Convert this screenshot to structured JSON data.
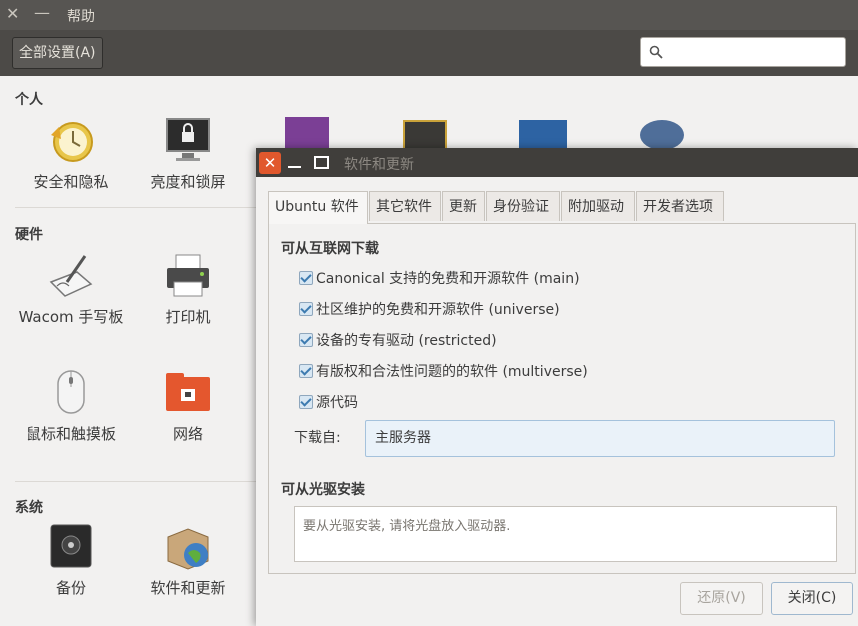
{
  "background_window": {
    "title": "帮助",
    "toolbar": {
      "all_settings_label": "全部设置(A)",
      "search_placeholder": ""
    },
    "sections": [
      {
        "title": "个人",
        "items": [
          "安全和隐私",
          "亮度和锁屏"
        ]
      },
      {
        "title": "硬件",
        "items": [
          "Wacom 手写板",
          "打印机",
          "鼠标和触摸板",
          "网络"
        ]
      },
      {
        "title": "系统",
        "items": [
          "备份",
          "软件和更新"
        ]
      }
    ]
  },
  "dialog": {
    "title": "软件和更新",
    "tabs": [
      "Ubuntu 软件",
      "其它软件",
      "更新",
      "身份验证",
      "附加驱动",
      "开发者选项"
    ],
    "active_tab": "Ubuntu 软件",
    "internet_heading": "可从互联网下载",
    "sources": [
      {
        "label": "Canonical 支持的免费和开源软件 (main)",
        "checked": true
      },
      {
        "label": "社区维护的免费和开源软件 (universe)",
        "checked": true
      },
      {
        "label": "设备的专有驱动 (restricted)",
        "checked": true
      },
      {
        "label": "有版权和合法性问题的的软件 (multiverse)",
        "checked": true
      },
      {
        "label": "源代码",
        "checked": true
      }
    ],
    "download_from_label": "下载自:",
    "download_from_value": "主服务器",
    "cdrom_heading": "可从光驱安装",
    "cdrom_message": "要从光驱安装, 请将光盘放入驱动器.",
    "buttons": {
      "revert": "还原(V)",
      "close": "关闭(C)"
    }
  },
  "colors": {
    "titlebar": "#575552",
    "dialog_titlebar": "#403e3b",
    "close_button": "#e1582d",
    "accent": "#3d7bb0"
  }
}
